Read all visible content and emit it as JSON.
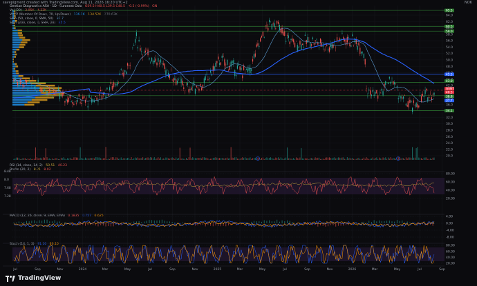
{
  "header": {
    "created_by": "savepigment created with TradingView.com, Aug 11, 2026 16:20 UTC+2",
    "currency": "NOK"
  },
  "symbol": {
    "name": "Gentian Diagnostics ASA · 1D · Euronext Oslo",
    "ohlc": "O39.5 H40.5 L39.5 C40.5",
    "change": "-0.5 (-0.99%)",
    "vol_chip": "GN"
  },
  "indicators": {
    "vol": {
      "label": "Vol (20)",
      "v1": "3.95K",
      "v2": "4.23K"
    },
    "vrvp": {
      "label": "VRVP (Number Of Rows, 70, Up/Down)",
      "v1": "136.1K",
      "v2": "134.52K",
      "v3": "270.63K"
    },
    "sma50": {
      "label": "SMA (50, close, 0, SMA, 50)",
      "v1": "37.7"
    },
    "sma200": {
      "label": "SMA (200, close, 0, SMA, 20)",
      "v1": "45.5"
    },
    "rsi": {
      "label": "RSI (14, close, 14, 2)",
      "v1": "50.51",
      "v2": "46.23"
    },
    "brsi": {
      "label": "BrsAn (20, 2)",
      "v1": "8.21",
      "v2": "8.02"
    },
    "macd": {
      "label": "MACD (12, 26, close, 9, EMA, EMA)",
      "v1": "0.1835",
      "v2": "0.757",
      "v3": "0.625"
    },
    "stoch": {
      "label": "Stoch (14, 1, 3)",
      "v1": "91.16",
      "v2": "86.10"
    }
  },
  "price_axis": {
    "ticks": [
      "64.0",
      "62.0",
      "60.0",
      "58.0",
      "56.0",
      "54.0",
      "52.0",
      "50.0",
      "48.0",
      "46.0",
      "44.0",
      "42.0",
      "40.0",
      "38.0",
      "36.0",
      "34.0",
      "32.0",
      "30.0",
      "28.0",
      "26.0",
      "24.0",
      "22.0",
      "20.0"
    ],
    "tags": [
      {
        "text": "65.5",
        "color": "#2f7d32"
      },
      {
        "text": "60.5",
        "color": "#2f7d32"
      },
      {
        "text": "59.0",
        "color": "#2f7d32"
      },
      {
        "text": "45.5",
        "color": "#2962ff"
      },
      {
        "text": "43.0",
        "color": "#2f7d32"
      },
      {
        "text": "GENT",
        "color": "#f23645"
      },
      {
        "text": "40.5",
        "color": "#f23645"
      },
      {
        "text": "38.8",
        "color": "#2f7d32"
      },
      {
        "text": "37.7",
        "color": "#2962ff"
      },
      {
        "text": "34.1",
        "color": "#2f7d32"
      }
    ]
  },
  "rsi_axis": {
    "ticks": [
      "80.00",
      "60.00",
      "40.00",
      "20.00"
    ],
    "left_ticks": [
      "8.48",
      "8.0",
      "7.68",
      "7.28"
    ]
  },
  "macd_axis": {
    "ticks": [
      "4.00",
      "0.00",
      "-4.00",
      "-8.00"
    ]
  },
  "stoch_axis": {
    "ticks": [
      "80.00",
      "60.00",
      "40.00",
      "20.00"
    ]
  },
  "time_axis": {
    "labels": [
      "Jul",
      "Sep",
      "Nov",
      "2024",
      "Mar",
      "May",
      "Jul",
      "Sep",
      "Nov",
      "2025",
      "Mar",
      "May",
      "Jul",
      "Sep",
      "Nov",
      "2026",
      "Mar",
      "May",
      "Jul",
      "Sep"
    ]
  },
  "colors": {
    "up": "#26a69a",
    "down": "#ef5350",
    "sma50": "#5d9fd6",
    "sma200": "#2962ff",
    "hline": "#2e7d32",
    "vp_up": "#2196f3",
    "vp_down": "#e0a020"
  },
  "branding": {
    "logo_text": "TradingView"
  }
}
